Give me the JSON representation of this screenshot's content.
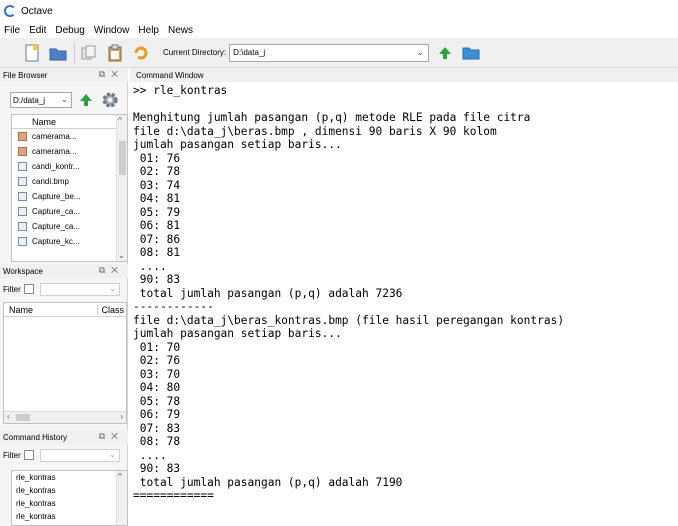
{
  "window": {
    "title": "Octave"
  },
  "menubar": {
    "items": [
      "File",
      "Edit",
      "Debug",
      "Window",
      "Help",
      "News"
    ]
  },
  "toolbar": {
    "current_dir_label": "Current Directory:",
    "current_dir_value": "D:\\data_j"
  },
  "file_browser": {
    "title": "File Browser",
    "path": "D:/data_j",
    "column_name": "Name",
    "files": [
      {
        "name": "camerama...",
        "type": "image"
      },
      {
        "name": "camerama...",
        "type": "image"
      },
      {
        "name": "candi_kontr...",
        "type": "file"
      },
      {
        "name": "candi.bmp",
        "type": "file"
      },
      {
        "name": "Capture_be...",
        "type": "file"
      },
      {
        "name": "Capture_ca...",
        "type": "file"
      },
      {
        "name": "Capture_ca...",
        "type": "file"
      },
      {
        "name": "Capture_kc...",
        "type": "file"
      }
    ]
  },
  "workspace": {
    "title": "Workspace",
    "filter_label": "Filter",
    "column_name": "Name",
    "column_class": "Class"
  },
  "command_history": {
    "title": "Command History",
    "filter_label": "Filter",
    "items": [
      "rle_kontras",
      "rle_kontras",
      "rle_kontras",
      "rle_kontras"
    ]
  },
  "command_window": {
    "title": "Command Window",
    "lines": [
      ">> rle_kontras",
      "",
      "Menghitung jumlah pasangan (p,q) metode RLE pada file citra",
      "file d:\\data_j\\beras.bmp , dimensi 90 baris X 90 kolom",
      "jumlah pasangan setiap baris...",
      " 01: 76",
      " 02: 78",
      " 03: 74",
      " 04: 81",
      " 05: 79",
      " 06: 81",
      " 07: 86",
      " 08: 81",
      " ....",
      " 90: 83",
      " total jumlah pasangan (p,q) adalah 7236",
      "------------",
      "file d:\\data_j\\beras_kontras.bmp (file hasil peregangan kontras)",
      "jumlah pasangan setiap baris...",
      " 01: 70",
      " 02: 76",
      " 03: 70",
      " 04: 80",
      " 05: 78",
      " 06: 79",
      " 07: 83",
      " 08: 78",
      " ....",
      " 90: 83",
      " total jumlah pasangan (p,q) adalah 7190",
      "============"
    ]
  }
}
